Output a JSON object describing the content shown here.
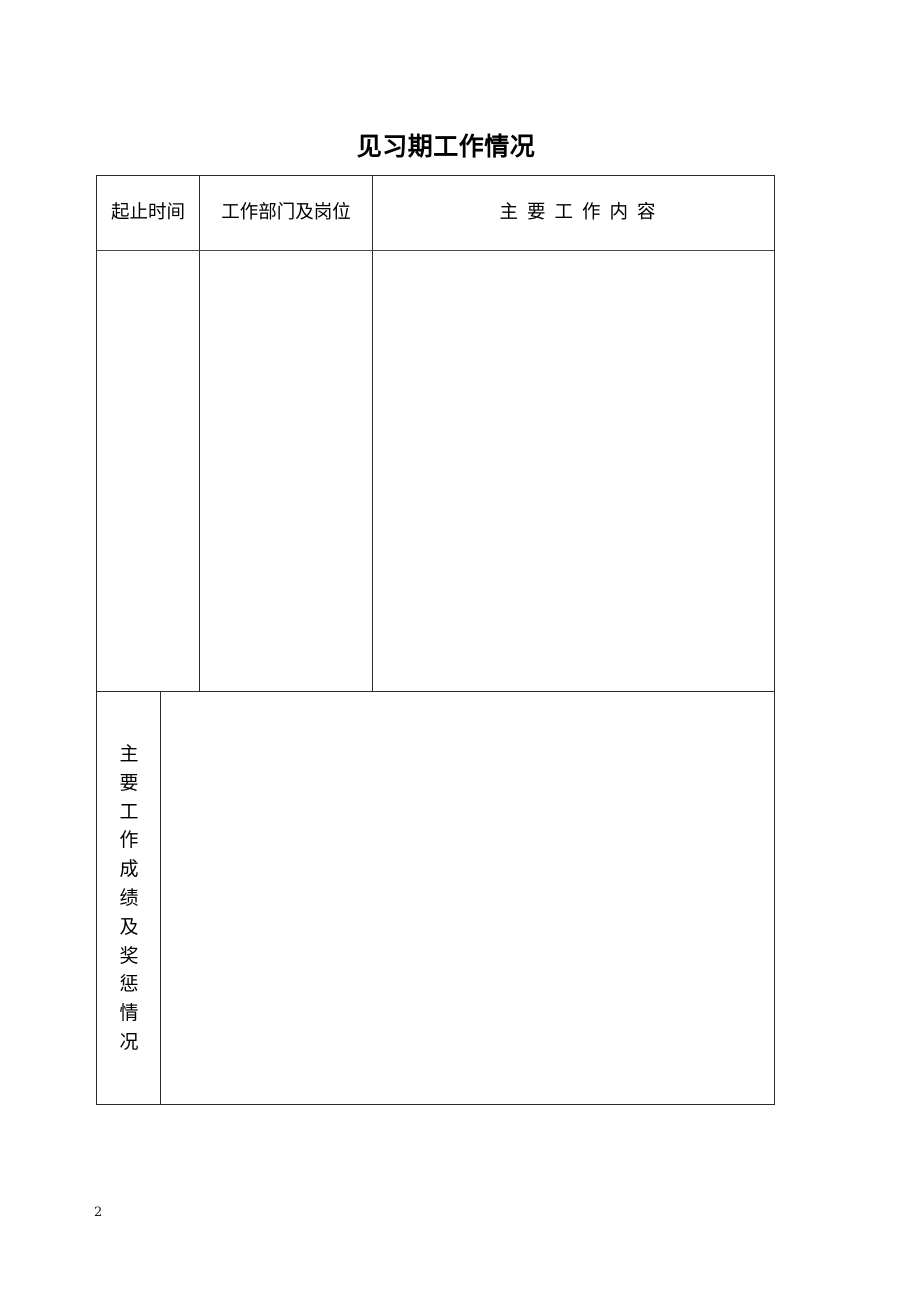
{
  "document": {
    "title": "见习期工作情况",
    "page_number": "2"
  },
  "table": {
    "headers": [
      {
        "id": "start-end-time",
        "label": "起止时间"
      },
      {
        "id": "department-and-post",
        "label": "工作部门及岗位"
      },
      {
        "id": "main-work-content",
        "label": "主要工作内容"
      }
    ],
    "body_rows": [
      {
        "start_end_time": "",
        "department_and_post": "",
        "main_work_content": ""
      }
    ],
    "achievements_section": {
      "vertical_label": "主要工作成绩及奖惩情况",
      "vertical_label_chars": [
        "主",
        "要",
        "工",
        "作",
        "成",
        "绩",
        "及",
        "奖",
        "惩",
        "情",
        "况"
      ],
      "value": ""
    }
  },
  "style": {
    "border_color": "#2a2a33",
    "background": "#ffffff",
    "text_color": "#000000"
  }
}
